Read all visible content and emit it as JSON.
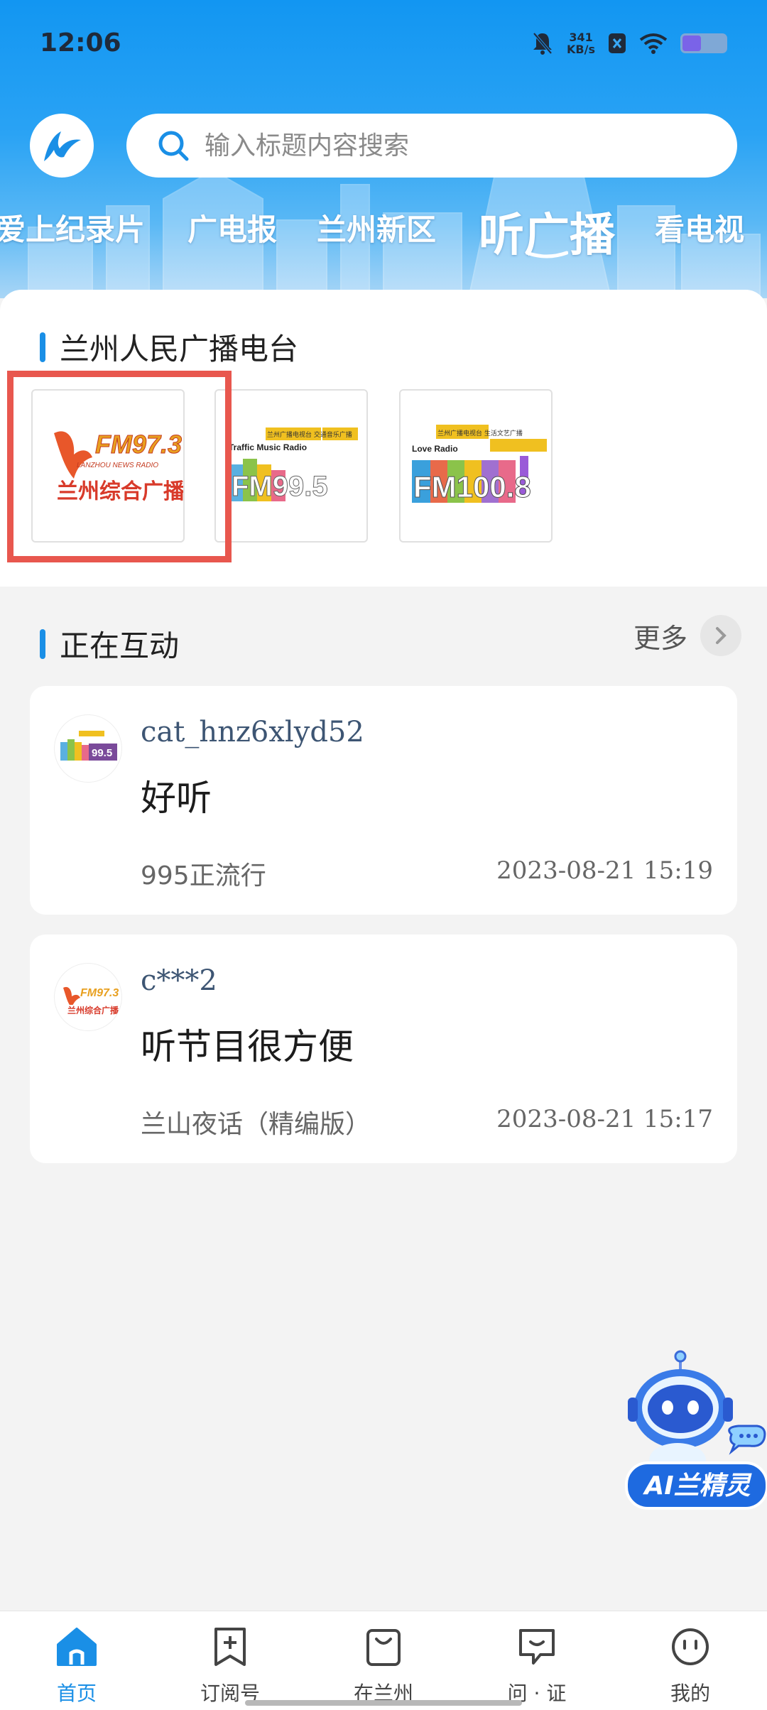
{
  "status_bar": {
    "time": "12:06",
    "net_speed_value": "341",
    "net_speed_unit": "KB/s"
  },
  "search": {
    "placeholder": "输入标题内容搜索"
  },
  "channels": [
    {
      "label": "爱上纪录片",
      "active": false
    },
    {
      "label": "广电报",
      "active": false
    },
    {
      "label": "兰州新区",
      "active": false
    },
    {
      "label": "听广播",
      "active": true
    },
    {
      "label": "看电视",
      "active": false
    }
  ],
  "radio_section": {
    "title": "兰州人民广播电台",
    "stations": [
      {
        "freq": "FM97.3",
        "sub": "LANZHOU NEWS RADIO",
        "name": "兰州综合广播"
      },
      {
        "freq": "FM99.5",
        "sub": "Traffic Music Radio",
        "name": "兰州广播电视台 交通音乐广播"
      },
      {
        "freq": "FM100.8",
        "sub": "Love Radio",
        "name": "兰州广播电视台 生活文艺广播"
      }
    ]
  },
  "interact_section": {
    "title": "正在互动",
    "more_label": "更多",
    "posts": [
      {
        "user": "cat_hnz6xlyd52",
        "message": "好听",
        "program": "995正流行",
        "datetime": "2023-08-21 15:19"
      },
      {
        "user": "c***2",
        "message": "听节目很方便",
        "program": "兰山夜话（精编版）",
        "datetime": "2023-08-21 15:17"
      }
    ]
  },
  "ai_assistant": {
    "label": "AI兰精灵"
  },
  "bottom_nav": [
    {
      "label": "首页",
      "icon": "home-icon",
      "active": true
    },
    {
      "label": "订阅号",
      "icon": "bookmark-plus-icon",
      "active": false
    },
    {
      "label": "在兰州",
      "icon": "shopping-bag-icon",
      "active": false
    },
    {
      "label": "问 · 证",
      "icon": "chat-bubble-icon",
      "active": false
    },
    {
      "label": "我的",
      "icon": "profile-face-icon",
      "active": false
    }
  ],
  "colors": {
    "accent": "#1a8fe6",
    "highlight": "#e8574e",
    "header_blue": "#1296f2"
  }
}
